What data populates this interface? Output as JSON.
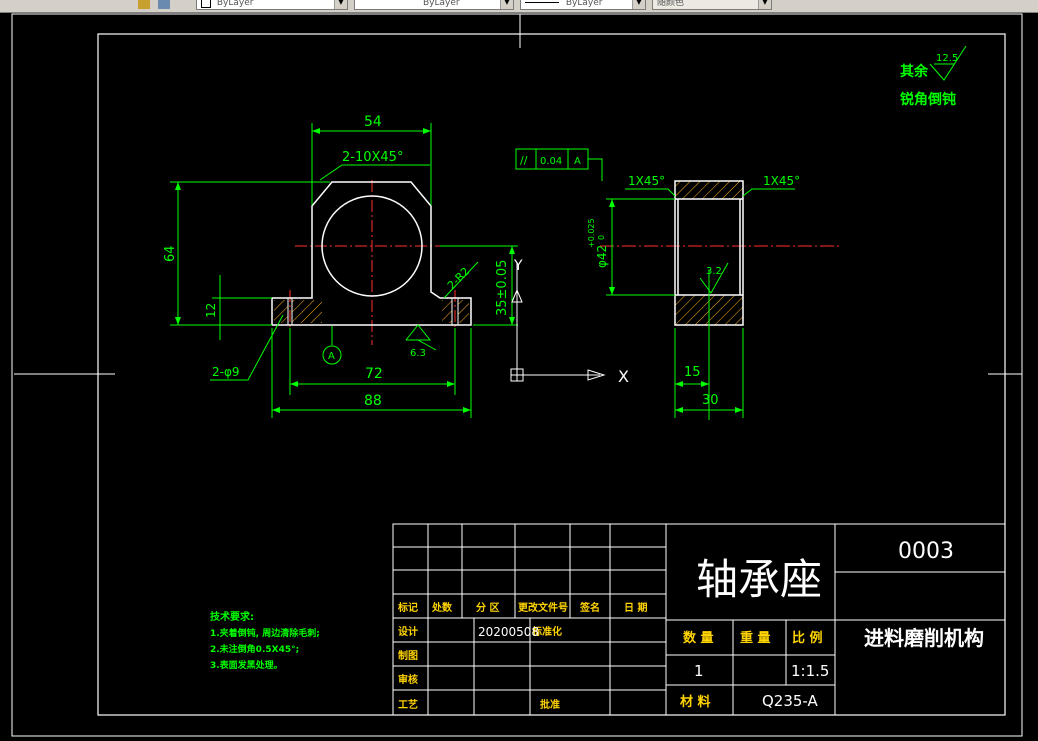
{
  "toolbar": {
    "layer_color": "ByLayer",
    "linetype": "ByLayer",
    "lineweight": "ByLayer",
    "plot_style": "随颜色"
  },
  "ucs": {
    "x_label": "X",
    "y_label": "Y"
  },
  "notes": {
    "line1": "其余",
    "line2": "锐角倒钝",
    "roughness": "12.5"
  },
  "front_view": {
    "dim_width_top": "54",
    "dim_chamfer_top": "2-10X45°",
    "dim_height_total": "64",
    "dim_base_height": "12",
    "dim_center_height": "35±0.05",
    "dim_r2": "2-R2",
    "dim_holes": "2-φ9",
    "dim_hole_spacing": "72",
    "dim_overall_width": "88",
    "datum": "A",
    "roughness": "6.3"
  },
  "side_view": {
    "gtol_symbol": "//",
    "gtol_value": "0.04",
    "gtol_datum": "A",
    "chamfer_left": "1X45°",
    "chamfer_right": "1X45°",
    "bore": "φ42",
    "bore_tol_upper": "+0.025",
    "bore_tol_lower": "0",
    "roughness": "3.2",
    "dim_15": "15",
    "dim_30": "30"
  },
  "tech_req": {
    "title": "技术要求:",
    "line1": "1.夹着倒钝, 周边清除毛刺;",
    "line2": "2.未注倒角0.5X45°;",
    "line3": "3.表面发黑处理。"
  },
  "title_block": {
    "part_name": "轴承座",
    "drawing_no": "0003",
    "assembly": "进料磨削机构",
    "col_mark": "标记",
    "col_count": "处数",
    "col_zone": "分 区",
    "col_doc": "更改文件号",
    "col_sign": "签名",
    "col_date": "日 期",
    "row_design": "设计",
    "design_date": "20200508",
    "standardize": "标准化",
    "row_draw": "制图",
    "row_check": "审核",
    "row_process": "工艺",
    "approve": "批准",
    "qty_label": "数 量",
    "weight_label": "重 量",
    "scale_label": "比 例",
    "qty": "1",
    "scale": "1:1.5",
    "material_label": "材 料",
    "material": "Q235-A"
  }
}
